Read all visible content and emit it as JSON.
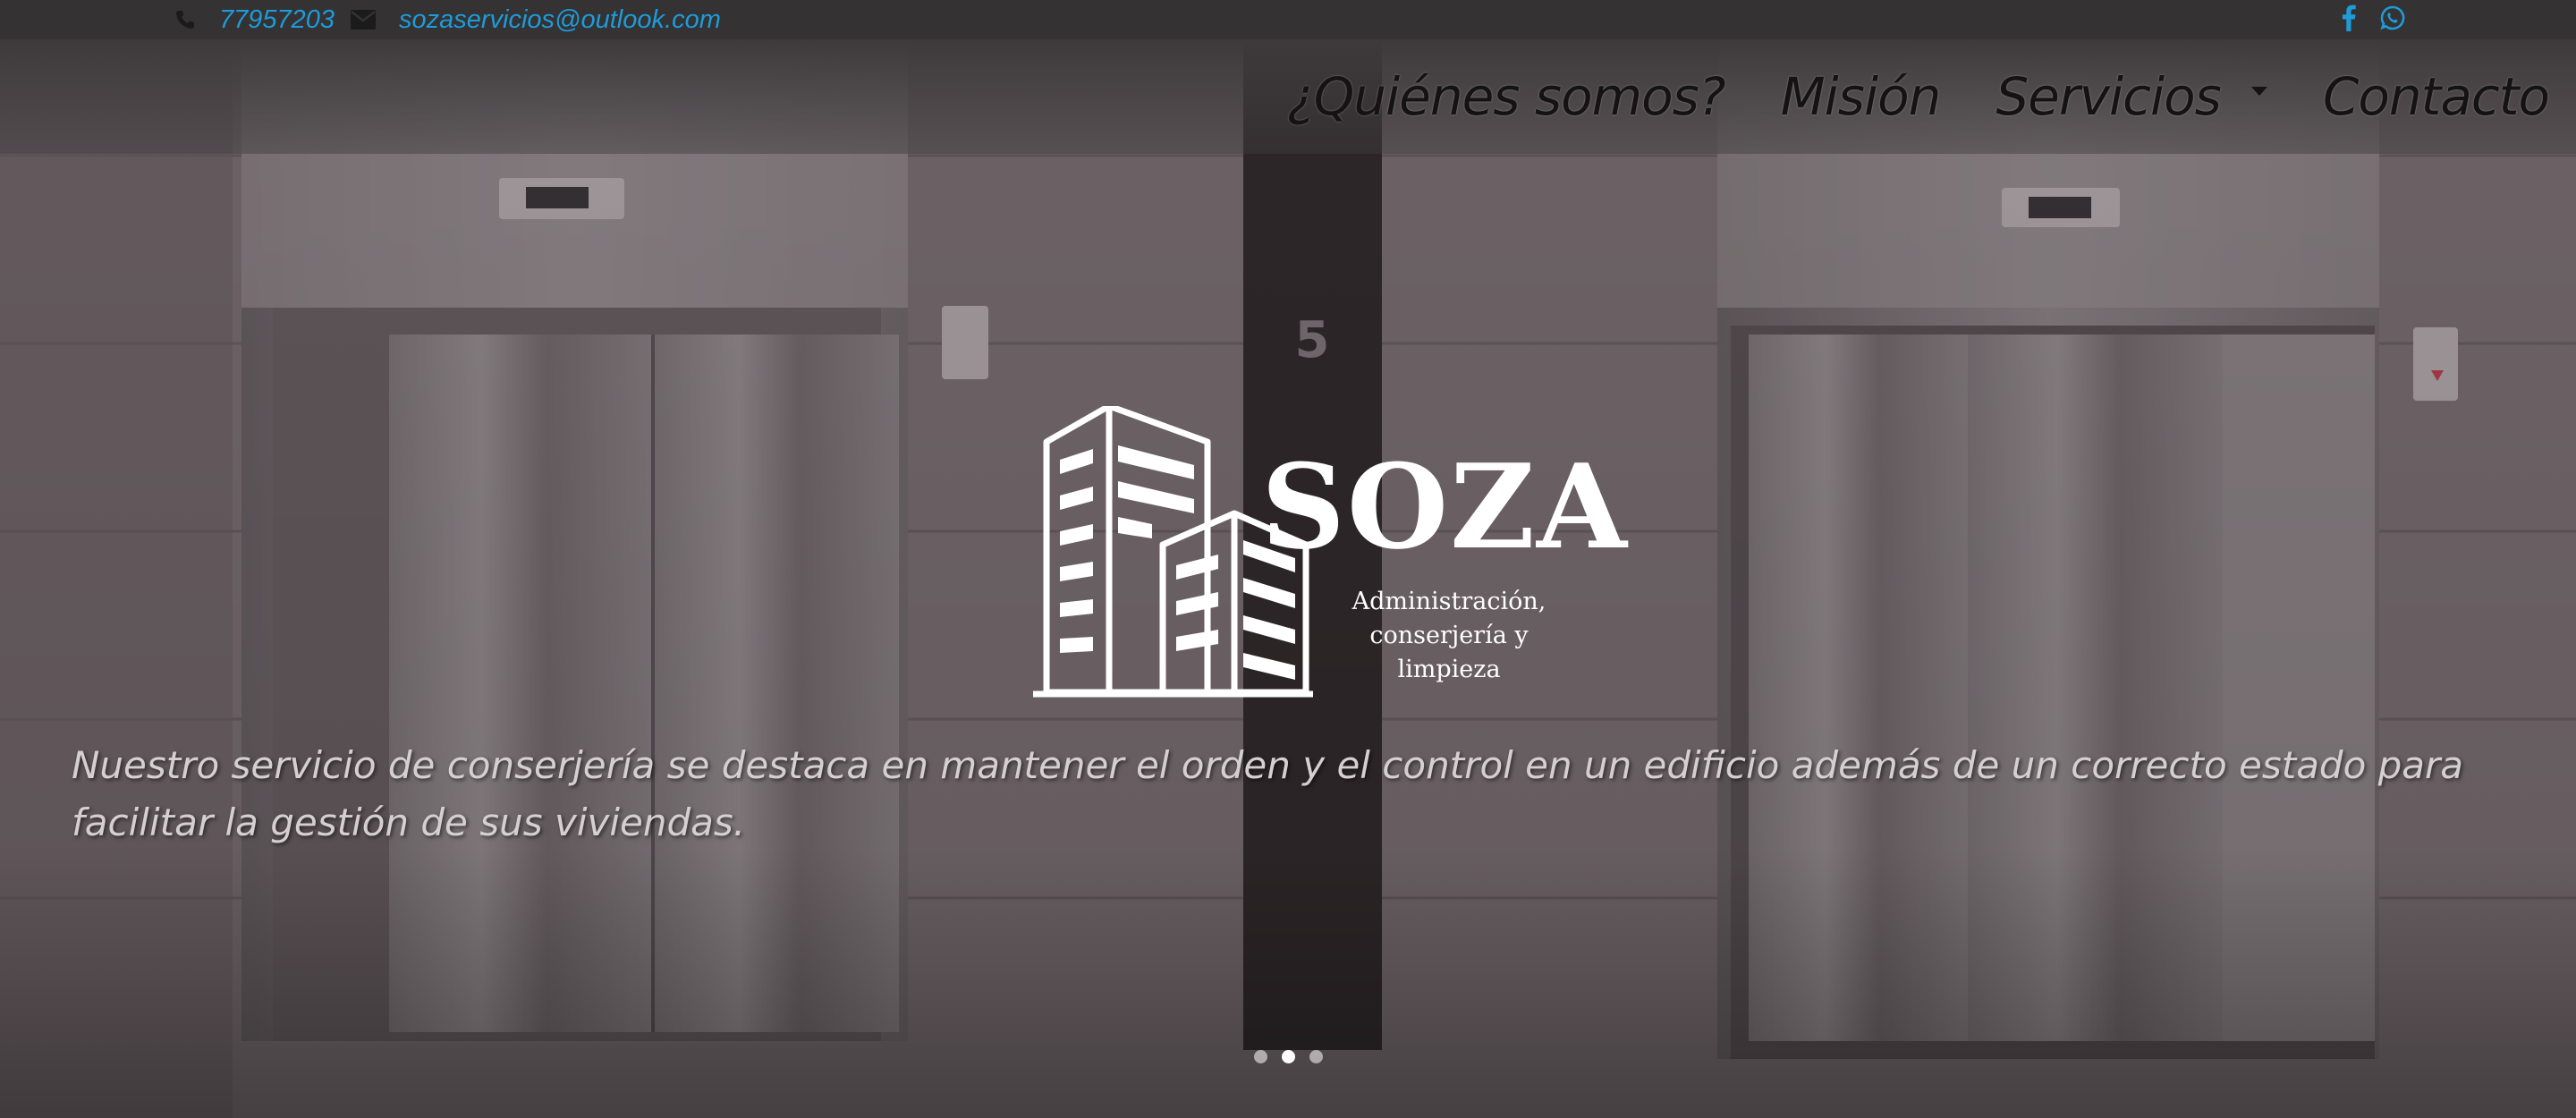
{
  "topbar": {
    "phone": "77957203",
    "email": "sozaservicios@outlook.com",
    "social": [
      {
        "name": "facebook-icon"
      },
      {
        "name": "whatsapp-icon"
      }
    ]
  },
  "nav": {
    "items": [
      {
        "label": "¿Quiénes somos?"
      },
      {
        "label": "Misión"
      },
      {
        "label": "Servicios",
        "dropdown": true
      },
      {
        "label": "Contacto"
      }
    ]
  },
  "hero": {
    "brand": "SOZA",
    "tagline": "Administración, conserjería y limpieza",
    "caption": "Nuestro servicio de conserjería se destaca en mantener el orden y el control en un edificio además de un correcto estado para facilitar la gestión de sus viviendas.",
    "slide_count": 3,
    "active_slide": 2
  },
  "colors": {
    "accent": "#1e9bd8",
    "topbar_bg": "#343233",
    "nav_text": "#141213"
  }
}
